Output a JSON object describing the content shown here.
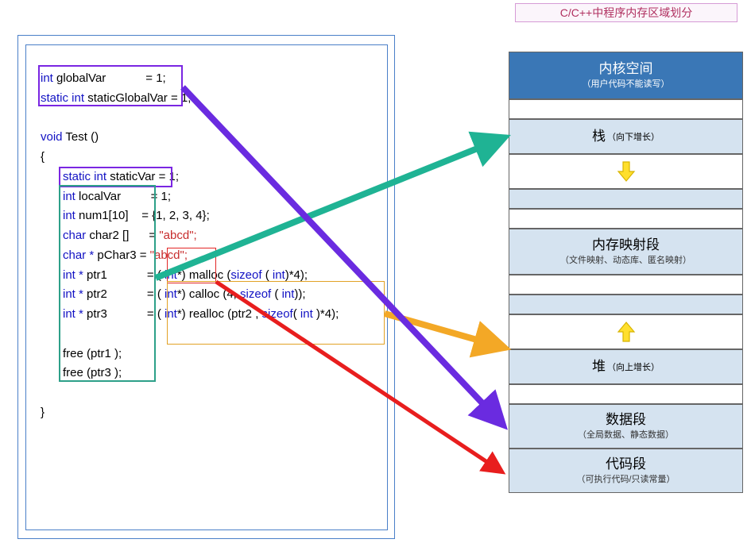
{
  "title": "C/C++中程序内存区域划分",
  "code": {
    "l1_a": "int ",
    "l1_b": "globalVar",
    "l1_c": " = 1;",
    "l2_a": "static int ",
    "l2_b": "staticGlobalVar",
    "l2_c": " = 1;",
    "l4_a": "void ",
    "l4_b": "Test ()",
    "l5": "{",
    "l6_a": "static int ",
    "l6_b": "staticVar",
    "l6_c": " = 1;",
    "l7_a": "int ",
    "l7_b": "localVar",
    "l7_c": " = 1;",
    "l8_a": "int ",
    "l8_b": "num1[10]",
    "l8_c": " = {1, 2, 3, 4};",
    "l9_a": "char ",
    "l9_b": "char2 []",
    "l9_c": " = ",
    "l9_d": "\"abcd\";",
    "l10_a": "char * ",
    "l10_b": "pChar3",
    "l10_c": " = ",
    "l10_d": "\"abcd\";",
    "l11_a": "int * ",
    "l11_b": "ptr1",
    "l11_c": " = ( ",
    "l11_d": "int",
    "l11_e": "*) malloc (",
    "l11_f": "sizeof",
    "l11_g": " ( ",
    "l11_h": "int",
    "l11_i": ")*4);",
    "l12_a": "int * ",
    "l12_b": "ptr2",
    "l12_c": " = ( ",
    "l12_d": "int",
    "l12_e": "*) calloc (4, ",
    "l12_f": "sizeof",
    "l12_g": " ( ",
    "l12_h": "int",
    "l12_i": "));",
    "l13_a": "int * ",
    "l13_b": "ptr3",
    "l13_c": " = ( ",
    "l13_d": "int",
    "l13_e": "*) realloc (ptr2 , ",
    "l13_f": "sizeof",
    "l13_g": "( ",
    "l13_h": "int",
    "l13_i": " )*4);",
    "l15": "free (ptr1 );",
    "l16": "free (ptr3 );",
    "l18": "}"
  },
  "mem": {
    "kernel_t": "内核空间",
    "kernel_s": "（用户代码不能读写）",
    "stack_t": "栈",
    "stack_s": "（向下增长）",
    "mmap_t": "内存映射段",
    "mmap_s": "（文件映射、动态库、匿名映射）",
    "heap_t": "堆",
    "heap_s": "（向上增长）",
    "data_t": "数据段",
    "data_s": "（全局数据、静态数据）",
    "code_t": "代码段",
    "code_s": "（可执行代码/只读常量）"
  },
  "arrows": {
    "green": {
      "color": "#1fb394"
    },
    "orange": {
      "color": "#f3a826"
    },
    "purple": {
      "color": "#6a2be0"
    },
    "red": {
      "color": "#e81e1e"
    }
  }
}
